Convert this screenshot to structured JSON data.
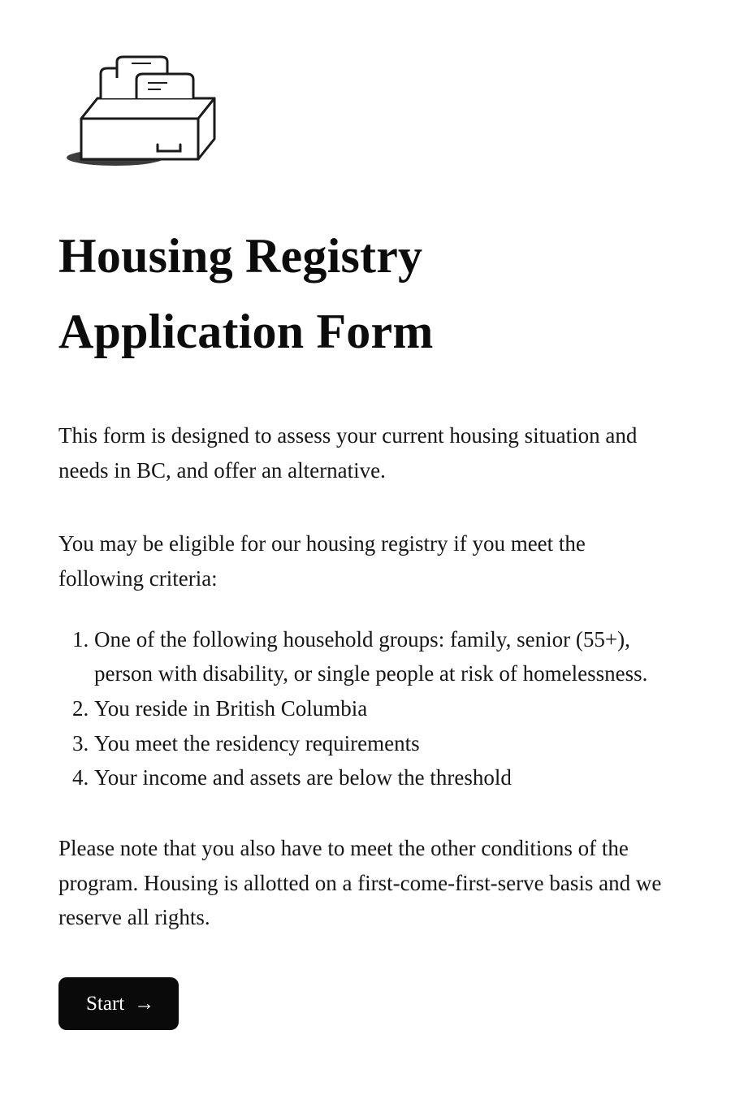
{
  "header": {
    "icon_name": "file-drawer-icon",
    "title": "Housing Registry Application Form"
  },
  "intro_text": "This form is designed to assess your current housing situation and needs in BC, and offer an alternative.",
  "eligibility_lead": "You may be eligible for our housing registry if you meet the following criteria:",
  "criteria": [
    "One of the following household groups: family, senior (55+), person with disability, or single people at risk of homelessness.",
    "You reside in British Columbia",
    "You meet the residency requirements",
    "Your income and assets are below the threshold"
  ],
  "note_text": "Please note that you also have to meet the other conditions of the program. Housing is allotted on a first-come-first-serve basis and we reserve all rights.",
  "actions": {
    "start_label": "Start",
    "start_arrow": "→"
  }
}
